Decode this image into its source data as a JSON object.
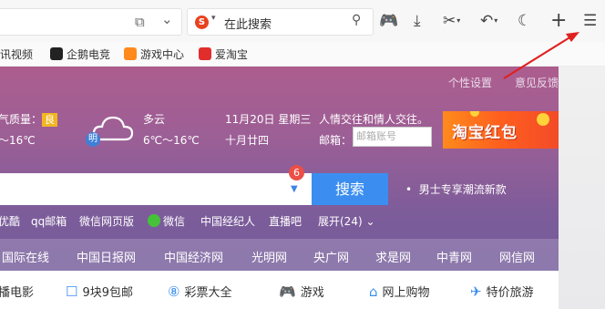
{
  "toolbar": {
    "search_placeholder": "在此搜索",
    "sogou_glyph": "S",
    "share_icon": "⧉",
    "chevron_icon": "⌄",
    "mag_icon": "⚲",
    "game_icon": "🎮",
    "download_icon": "⤓",
    "scissors_icon": "✂",
    "undo_icon": "↶",
    "moon_icon": "☾",
    "plus_icon": "+",
    "menu_icon": "☰"
  },
  "bookmarks": [
    {
      "label": "腾讯视频",
      "color": "#2a8cf0"
    },
    {
      "label": "企鹅电竞",
      "color": "#222222"
    },
    {
      "label": "游戏中心",
      "color": "#ff8a1c"
    },
    {
      "label": "爱淘宝",
      "color": "#e22d2d"
    }
  ],
  "page": {
    "top_links": [
      "个性设置",
      "意见反馈"
    ],
    "air_quality_label": "气质量：",
    "air_quality_value": "良",
    "today_temp": "～16℃",
    "weather_name": "多云",
    "weather_temp": "6℃～16℃",
    "day_badge": "明",
    "date_line": "11月20日 星期三",
    "lunar_date": "十月廿四",
    "promo_text": "人情交往和情人交往。",
    "mail_label": "邮箱：",
    "mail_placeholder": "邮箱账号",
    "banner_text": "淘宝红包",
    "search_badge": "6",
    "search_button": "搜索",
    "search_promo": "男士专享潮流新款",
    "quick_links": [
      "优酷",
      "qq邮箱",
      "微信网页版",
      "微信",
      "中国经纪人",
      "直播吧",
      "展开(24) ⌄"
    ],
    "news_links": [
      "国际在线",
      "中国日报网",
      "中国经济网",
      "光明网",
      "央广网",
      "求是网",
      "中青网",
      "网信网"
    ],
    "bottom_links": [
      {
        "label": "播电影",
        "icon": ""
      },
      {
        "label": "9块9包邮",
        "icon": "☐"
      },
      {
        "label": "彩票大全",
        "icon": "⑧"
      },
      {
        "label": "游戏",
        "icon": "🎮"
      },
      {
        "label": "网上购物",
        "icon": "⌂"
      },
      {
        "label": "特价旅游",
        "icon": "✈"
      }
    ]
  },
  "colors": {
    "accent_blue": "#3b8ef0",
    "arrow_red": "#e02020"
  }
}
